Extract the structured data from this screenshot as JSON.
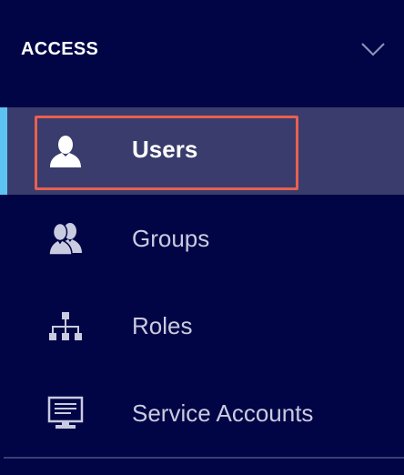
{
  "section": {
    "title": "ACCESS",
    "expanded": true
  },
  "items": [
    {
      "label": "Users",
      "icon": "user-icon",
      "active": true
    },
    {
      "label": "Groups",
      "icon": "group-icon",
      "active": false
    },
    {
      "label": "Roles",
      "icon": "hierarchy-icon",
      "active": false
    },
    {
      "label": "Service Accounts",
      "icon": "monitor-icon",
      "active": false
    }
  ],
  "colors": {
    "background": "#020545",
    "active_background": "#393c6c",
    "active_indicator": "#5ec2f0",
    "focus_outline": "#e8604f",
    "inactive_text": "#c9cbe0",
    "active_text": "#ffffff"
  }
}
